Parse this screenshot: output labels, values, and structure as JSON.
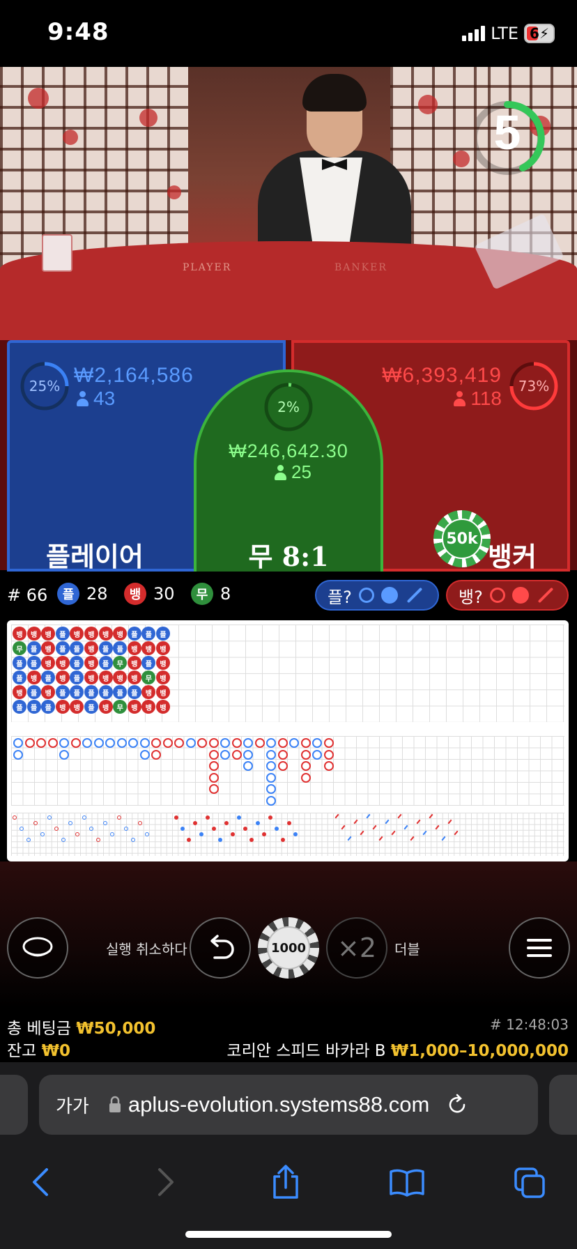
{
  "status_bar": {
    "time": "9:48",
    "network": "LTE",
    "battery": "6"
  },
  "video": {
    "countdown": "5",
    "table_label_left": "PLAYER",
    "table_label_right": "BANKER"
  },
  "bets": {
    "player": {
      "percent": "25%",
      "amount": "₩2,164,586",
      "players": "43",
      "label": "플레이어"
    },
    "tie": {
      "percent": "2%",
      "amount": "₩246,642.30",
      "players": "25",
      "label": "무 8:1"
    },
    "banker": {
      "percent": "73%",
      "amount": "₩6,393,419",
      "players": "118",
      "label": "뱅커",
      "chip": "50k"
    }
  },
  "stats": {
    "round": "# 66",
    "player_icon": "플",
    "player_count": "28",
    "banker_icon": "뱅",
    "banker_count": "30",
    "tie_icon": "무",
    "tie_count": "8",
    "player_predict": "플?",
    "banker_predict": "뱅?"
  },
  "controls": {
    "undo_label": "실행 취소하다",
    "chip_value": "1000",
    "double_symbol": "×2",
    "double_label": "더블"
  },
  "info": {
    "total_bet_label": "총 베팅금",
    "total_bet_value": "₩50,000",
    "balance_label": "잔고",
    "balance_value": "₩0",
    "time": "# 12:48:03",
    "table_name": "코리안 스피드 바카라 B",
    "limits": "₩1,000–10,000,000"
  },
  "browser": {
    "text_size": "가가",
    "url": "aplus-evolution.systems88.com"
  },
  "colors": {
    "player": "#2f66d4",
    "banker": "#d42c2c",
    "tie": "#3cb43c",
    "gold": "#f2c12e"
  }
}
